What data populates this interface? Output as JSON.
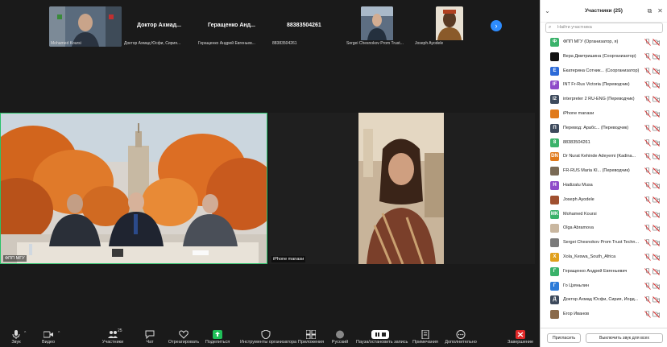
{
  "filmstrip": {
    "tiles": [
      {
        "label": "Mohamed Koursi"
      },
      {
        "name": "Доктор  Ахмад...",
        "label": "Доктор Ахмад Юсфи, Сирия..."
      },
      {
        "name": "Геращенко  Анд...",
        "label": "Геращенко Андрей Евгеньев..."
      },
      {
        "name": "88383504261",
        "label": "88383504261"
      },
      {
        "label": "Sergei Chesnokov Prom Trust..."
      },
      {
        "label": "Joseph Ayodele"
      }
    ],
    "next_icon": "chevron-right-icon"
  },
  "main_tiles": [
    {
      "label": "ФПП МГУ"
    },
    {
      "label": "iPhone ⁣manasи⁣"
    }
  ],
  "toolbar": {
    "items": [
      {
        "label": "Звук",
        "icon": "microphone-icon"
      },
      {
        "label": "Видео",
        "icon": "video-icon"
      },
      {
        "label": "Участники",
        "icon": "participants-icon",
        "badge": "25"
      },
      {
        "label": "Чат",
        "icon": "chat-icon"
      },
      {
        "label": "Отреагировать",
        "icon": "heart-icon"
      },
      {
        "label": "Поделиться",
        "icon": "share-icon"
      },
      {
        "label": "Инструменты организатора",
        "icon": "shield-icon"
      },
      {
        "label": "Приложения",
        "icon": "apps-icon"
      },
      {
        "label": "Русский",
        "icon": "globe-icon"
      },
      {
        "label": "Пауза/остановить запись",
        "icon": "pause-record-icon"
      },
      {
        "label": "Примечания",
        "icon": "notes-icon"
      },
      {
        "label": "Дополнительно",
        "icon": "more-icon"
      },
      {
        "label": "Завершение",
        "icon": "end-icon"
      }
    ]
  },
  "participants_panel": {
    "title": "Участники (25)",
    "search_placeholder": "Найти участника",
    "participants": [
      {
        "name": "ФПП МГУ (Организатор, я)",
        "avatar": "Ф",
        "color": "#3ab26a"
      },
      {
        "name": "Вера Дмитришина (Соорганизатор)",
        "avatar": "",
        "color": "#111111"
      },
      {
        "name": "Екатерина Сотник... (Соорганизатор)",
        "avatar": "Е",
        "color": "#2d6bd8"
      },
      {
        "name": "INT Fr-Rus Victoria (Переводчик)",
        "avatar": "IF",
        "color": "#8e4bc9"
      },
      {
        "name": "interpreter 2 RU-ENG (Переводчик)",
        "avatar": "I2",
        "color": "#3d4a5c"
      },
      {
        "name": "iPhone ⁣manasи⁣",
        "avatar": "",
        "color": "#e07a1c"
      },
      {
        "name": "Перевод: Арабс... (Переводчик)",
        "avatar": "П",
        "color": "#3d4a5c"
      },
      {
        "name": "88383504261",
        "avatar": "8",
        "color": "#3ab26a"
      },
      {
        "name": "Dr Nurat Kehinde Adeyemi (Kadina...",
        "avatar": "DN",
        "color": "#e07a1c"
      },
      {
        "name": "FR-RUS Maria Kl... (Переводчик)",
        "avatar": "",
        "color": "#7a6a55"
      },
      {
        "name": "Hadizatu Musa",
        "avatar": "H",
        "color": "#8e4bc9"
      },
      {
        "name": "Joseph Ayodele",
        "avatar": "",
        "color": "#a05030"
      },
      {
        "name": "Mohamed Koursi",
        "avatar": "MK",
        "color": "#3ab26a"
      },
      {
        "name": "Olga Abramova",
        "avatar": "",
        "color": "#c9b7a0"
      },
      {
        "name": "Sergei Chesnokov Prom Trust Techn...",
        "avatar": "",
        "color": "#7a7a7a"
      },
      {
        "name": "Xola_Keswa_South_Africa",
        "avatar": "X",
        "color": "#e0a01c"
      },
      {
        "name": "Геращенко Андрей Евгеньевич",
        "avatar": "Г",
        "color": "#3ab26a"
      },
      {
        "name": "Го Цзяньлин",
        "avatar": "Г",
        "color": "#2d7bd8"
      },
      {
        "name": "Доктор Ахмад Юсфи, Сирия, Иорд...",
        "avatar": "Д",
        "color": "#3d4a5c"
      },
      {
        "name": "Егор Иванов",
        "avatar": "",
        "color": "#8a6a4a"
      }
    ],
    "invite_label": "Пригласить",
    "unmute_all_label": "Выключить звук для всех"
  }
}
